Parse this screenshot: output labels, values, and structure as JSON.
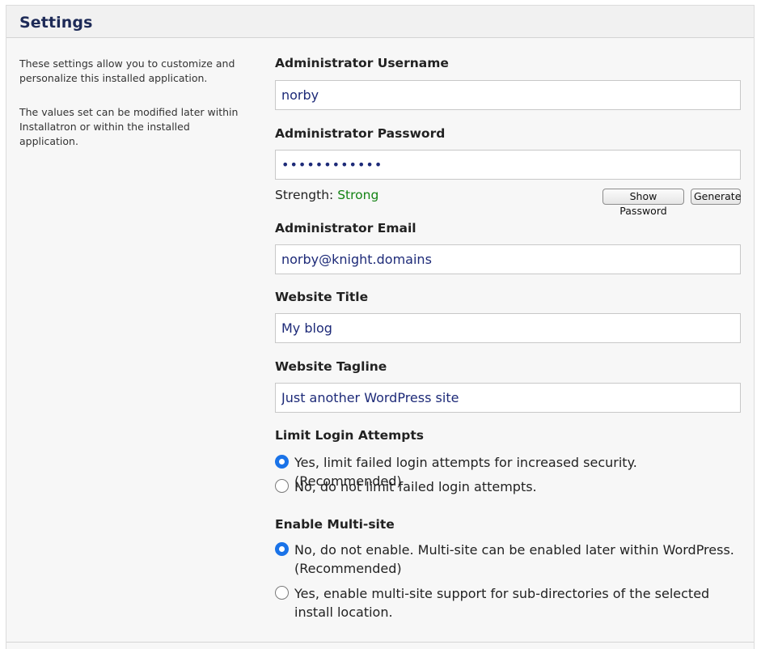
{
  "settings": {
    "title": "Settings",
    "description": [
      "These settings allow you to customize and personalize this installed application.",
      "The values set can be modified later within Installatron or within the installed application."
    ],
    "admin_username": {
      "label": "Administrator Username",
      "value": "norby"
    },
    "admin_password": {
      "label": "Administrator Password",
      "value": "••••••••••••",
      "strength_label": "Strength:",
      "strength_value": "Strong",
      "strength_color": "#148314",
      "show_password_label": "Show Password",
      "generate_label": "Generate"
    },
    "admin_email": {
      "label": "Administrator Email",
      "value": "norby@knight.domains"
    },
    "website_title": {
      "label": "Website Title",
      "value": "My blog"
    },
    "website_tagline": {
      "label": "Website Tagline",
      "value": "Just another WordPress site"
    },
    "limit_login": {
      "label": "Limit Login Attempts",
      "options": [
        {
          "label": "Yes, limit failed login attempts for increased security. (Recommended)",
          "checked": true
        },
        {
          "label": "No, do not limit failed login attempts.",
          "checked": false
        }
      ]
    },
    "multisite": {
      "label": "Enable Multi-site",
      "options": [
        {
          "label": "No, do not enable. Multi-site can be enabled later within WordPress. (Recommended)",
          "checked": true
        },
        {
          "label": "Yes, enable multi-site support for sub-directories of the selected install location.",
          "checked": false
        }
      ]
    }
  },
  "colors": {
    "accent": "#1a73e8",
    "title": "#1d2a57",
    "input_text": "#1d2a78"
  }
}
